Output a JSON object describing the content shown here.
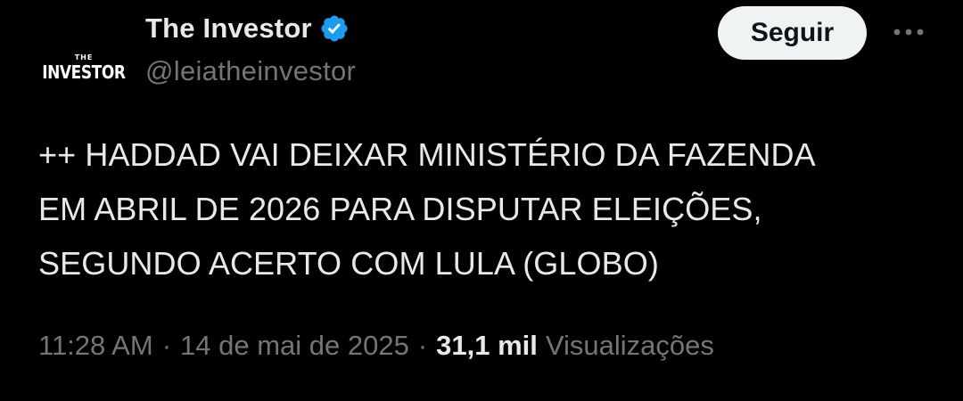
{
  "account": {
    "avatar_logo_top": "THE",
    "avatar_logo_main": "INVESTOR",
    "display_name": "The Investor",
    "handle": "@leiatheinvestor",
    "verified_color": "#1d9bf0"
  },
  "actions": {
    "follow_label": "Seguir",
    "more_icon": "ellipsis-icon"
  },
  "tweet": {
    "lines": [
      "++ HADDAD VAI DEIXAR MINISTÉRIO DA FAZENDA",
      "EM ABRIL DE 2026 PARA DISPUTAR ELEIÇÕES,",
      "SEGUNDO ACERTO COM LULA (GLOBO)"
    ]
  },
  "meta": {
    "time": "11:28 AM",
    "separator": "·",
    "date": "14 de mai de 2025",
    "views_count": "31,1 mil",
    "views_label": "Visualizações"
  },
  "colors": {
    "background": "#000000",
    "text_primary": "#e7e9ea",
    "text_secondary": "#71767b",
    "button_bg": "#eff3f4",
    "button_text": "#0f1419"
  }
}
